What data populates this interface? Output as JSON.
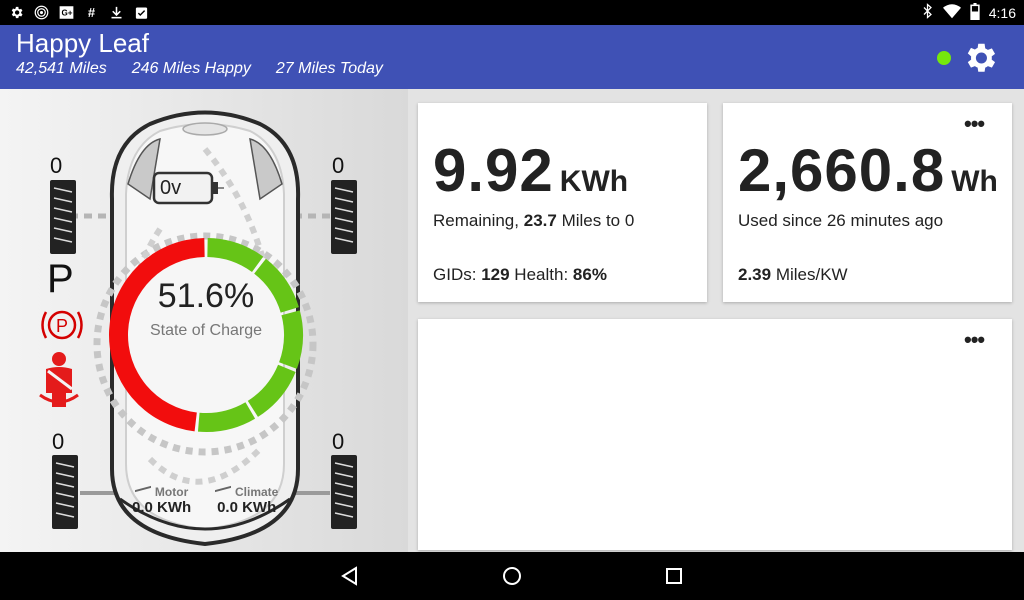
{
  "statusbar": {
    "left_icons": [
      "settings-gear-icon",
      "wireless-icon",
      "g-plus-icon",
      "hash-icon",
      "download-icon",
      "clipboard-check-icon"
    ],
    "right_icons": [
      "bluetooth-icon",
      "wifi-icon",
      "battery-icon"
    ],
    "time": "4:16"
  },
  "appbar": {
    "title": "Happy Leaf",
    "odometer": "42,541 Miles",
    "happy_miles": "246 Miles Happy",
    "today_miles": "27 Miles Today",
    "connection_color": "#76e80c",
    "bg_color": "#3f51b5"
  },
  "dashboard": {
    "tire_pressures": {
      "front_left": "0",
      "front_right": "0",
      "rear_left": "0",
      "rear_right": "0"
    },
    "gear": "P",
    "parking_brake_icon": "parking-brake-icon",
    "seatbelt_icon": "seatbelt-warning-icon",
    "voltage": "0v",
    "soc": {
      "value": "51.6%",
      "label": "State of Charge",
      "fraction": 0.516
    },
    "motor": {
      "label": "Motor",
      "value": "0.0 KWh"
    },
    "climate": {
      "label": "Climate",
      "value": "0.0 KWh"
    }
  },
  "cards": {
    "energy": {
      "value": "9.92",
      "unit": "KWh",
      "remaining_label": "Remaining,",
      "remaining_miles": "23.7",
      "remaining_suffix": "Miles to 0",
      "gids_label": "GIDs:",
      "gids_value": "129",
      "health_label": "Health:",
      "health_value": "86%"
    },
    "usage": {
      "value": "2,660.8",
      "unit": "Wh",
      "since": "Used since 26 minutes ago",
      "efficiency_value": "2.39",
      "efficiency_unit": "Miles/KW",
      "menu": "•••"
    },
    "empty": {
      "menu": "•••"
    }
  },
  "navbar": {
    "buttons": [
      "back-icon",
      "home-icon",
      "recents-icon"
    ]
  }
}
